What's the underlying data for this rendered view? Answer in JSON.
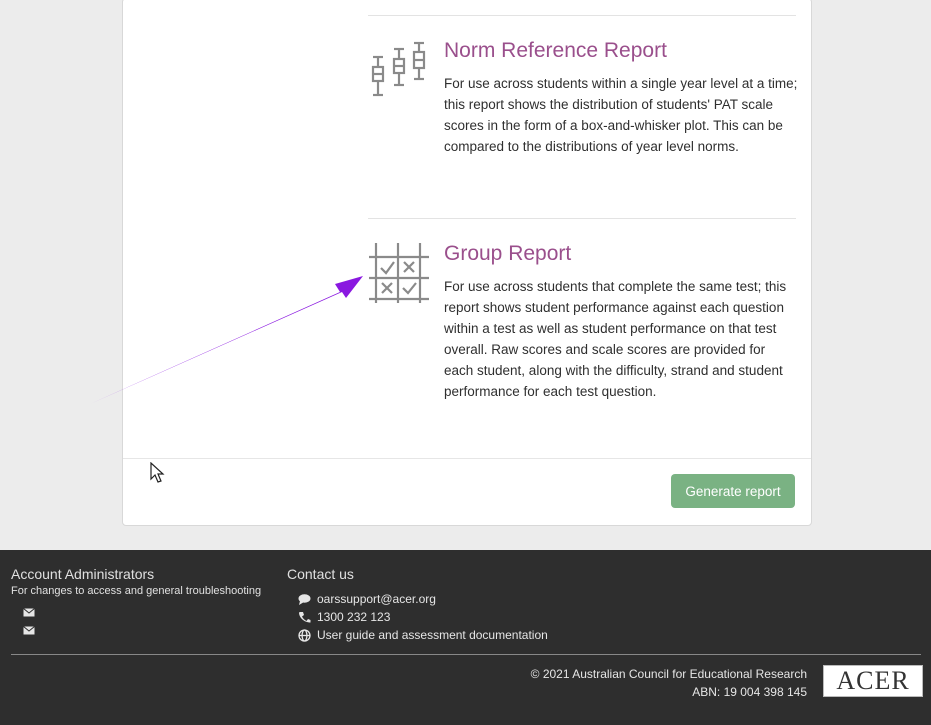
{
  "reports": [
    {
      "title": "Norm Reference Report",
      "description": "For use across students within a single year level at a time; this report shows the distribution of students' PAT scale scores in the form of a box-and-whisker plot. This can be compared to the distributions of year level norms.",
      "icon": "box-whisker-icon"
    },
    {
      "title": "Group Report",
      "description": "For use across students that complete the same test; this report shows student performance against each question within a test as well as student performance on that test overall. Raw scores and scale scores are provided for each student, along with the difficulty, strand and student performance for each test question.",
      "icon": "grid-check-icon"
    }
  ],
  "actions": {
    "generate_label": "Generate report"
  },
  "footer": {
    "admins": {
      "heading": "Account Administrators",
      "subtext": "For changes to access and general troubleshooting"
    },
    "contact": {
      "heading": "Contact us",
      "email": "oarssupport@acer.org",
      "phone": "1300 232 123",
      "guide": "User guide and assessment documentation"
    },
    "copyright": "© 2021 Australian Council for Educational Research",
    "abn": "ABN: 19 004 398 145",
    "logo_text": "ACER"
  },
  "colors": {
    "title": "#9a4f8c",
    "button": "#7ab283",
    "footer_bg": "#2e2e2e",
    "arrow": "#8a18e0"
  }
}
